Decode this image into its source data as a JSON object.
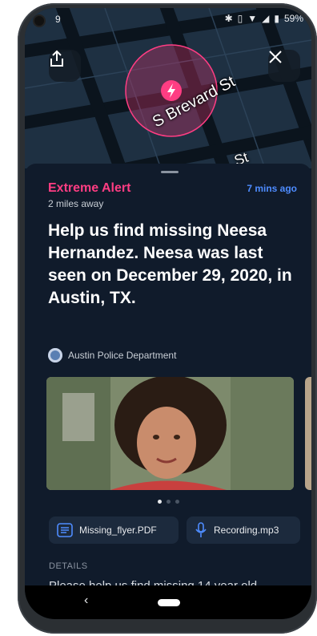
{
  "status_bar": {
    "time": "9",
    "battery": "59%"
  },
  "map": {
    "street_1": "S Brevard St",
    "street_2": "St"
  },
  "alert": {
    "type": "Extreme Alert",
    "time_ago": "7 mins ago",
    "distance": "2 miles away",
    "headline": "Help us find missing Neesa Hernandez. Neesa was last seen on December 29, 2020, in Austin, TX.",
    "agency": "Austin Police Department"
  },
  "attachments": [
    {
      "label": "Missing_flyer.PDF",
      "icon": "document-icon"
    },
    {
      "label": "Recording.mp3",
      "icon": "microphone-icon"
    }
  ],
  "details": {
    "label": "DETAILS",
    "text": "Please help us find missing 14 year old"
  },
  "carousel": {
    "count": 3,
    "active": 0
  },
  "colors": {
    "alert_pink": "#ff3d83",
    "time_blue": "#4e8cff",
    "sheet_bg": "#101b2b",
    "chip_bg": "#1c2a3d"
  }
}
